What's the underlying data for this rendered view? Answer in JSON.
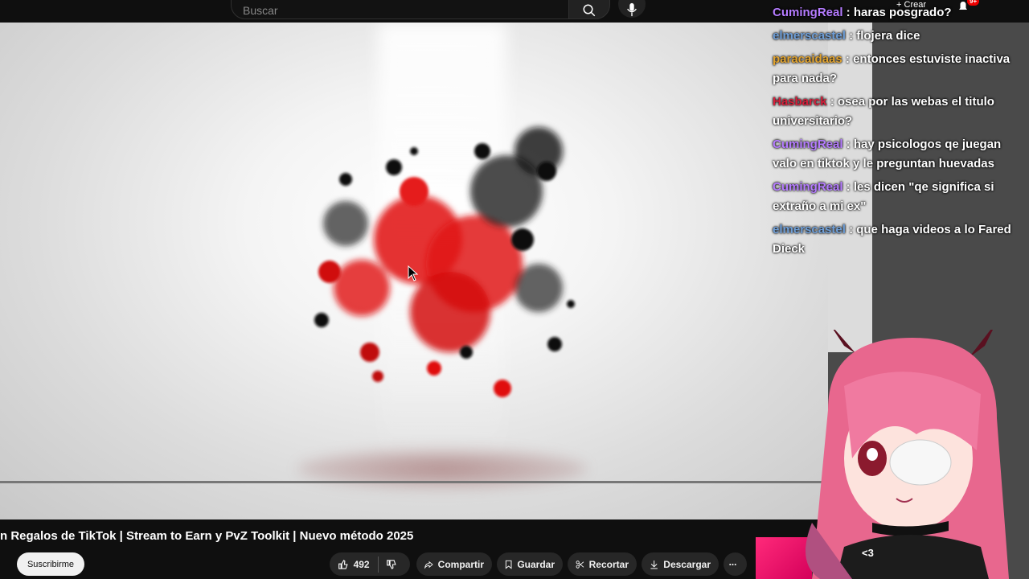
{
  "search": {
    "placeholder": "Buscar"
  },
  "header": {
    "create_label": "Crear",
    "notifications_badge": "9+"
  },
  "chat": {
    "messages": [
      {
        "user": "CumingReal",
        "color": "#b57cff",
        "text": " : haras posgrado?"
      },
      {
        "user": "elmerscastel",
        "color": "#6f9fd8",
        "text": " : flojera dice"
      },
      {
        "user": "paracaidaas",
        "color": "#e1a32f",
        "text": " : entonces estuviste inactiva para nada?"
      },
      {
        "user": "Hasbarck",
        "color": "#d81e3a",
        "text": " : osea por las webas el titulo universitario?"
      },
      {
        "user": "CumingReal",
        "color": "#b57cff",
        "text": " : hay psicologos qe juegan valo en tiktok y le preguntan huevadas"
      },
      {
        "user": "CumingReal",
        "color": "#b57cff",
        "text": " : les dicen \"qe significa si extraño a mi ex\""
      },
      {
        "user": "elmerscastel",
        "color": "#6f9fd8",
        "text": " : que haga videos a lo Fared Dieck"
      }
    ]
  },
  "video": {
    "title": "n Regalos de TikTok | Stream to Earn y PvZ Toolkit | Nuevo método 2025",
    "subscribe_label": "Suscribirme",
    "likes": "492",
    "share_label": "Compartir",
    "save_label": "Guardar",
    "clip_label": "Recortar",
    "download_label": "Descargar"
  },
  "overlay": {
    "sticker_text": "<3"
  }
}
